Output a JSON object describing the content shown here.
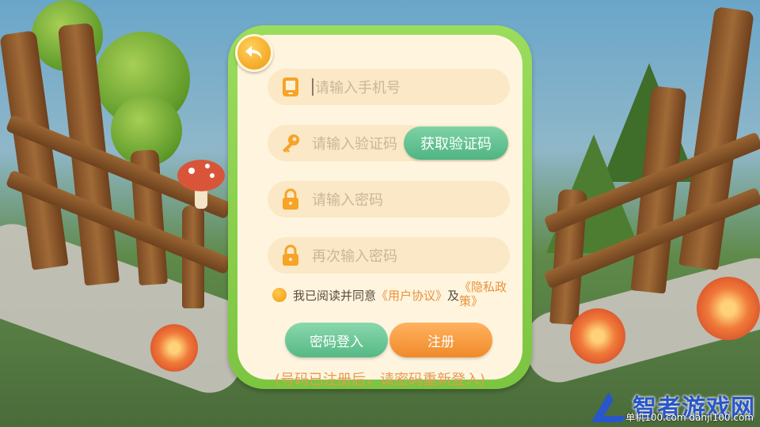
{
  "form": {
    "phone_placeholder": "请输入手机号",
    "code_placeholder": "请输入验证码",
    "get_code_label": "获取验证码",
    "password_placeholder": "请输入密码",
    "confirm_placeholder": "再次输入密码"
  },
  "agreement": {
    "prefix": "我已阅读并同意",
    "user_agreement": "《用户协议》",
    "and": "及",
    "privacy_policy": "《隐私政策》"
  },
  "buttons": {
    "login_label": "密码登入",
    "register_label": "注册"
  },
  "hint": "(号码已注册后，请密码重新登入)",
  "watermark": {
    "title": "智者游戏网",
    "subtitle": "单机100.com",
    "url": "danji100.com"
  },
  "colors": {
    "panel_border": "#9bdc5c",
    "panel_bg": "#fff5df",
    "field_bg": "#fbe8c6",
    "green_button": "#55b885",
    "orange_button": "#f08a2a",
    "link": "#e8913a"
  },
  "icons": [
    "back-icon",
    "phone-icon",
    "key-icon",
    "lock-icon",
    "lock-icon",
    "checkbox-icon"
  ]
}
